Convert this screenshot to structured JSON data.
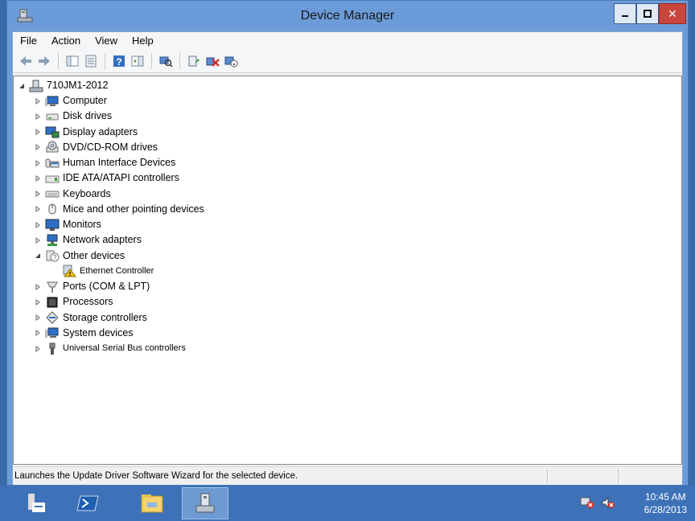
{
  "window": {
    "title": "Device Manager"
  },
  "menu": [
    "File",
    "Action",
    "View",
    "Help"
  ],
  "toolbar": [
    "back-icon",
    "forward-icon",
    "console-tree-icon",
    "properties-icon",
    "help-icon",
    "action-pane-icon",
    "scan-hardware-icon",
    "update-driver-icon",
    "uninstall-device-icon",
    "disable-device-icon"
  ],
  "tree": {
    "root": "710JM1-2012",
    "items": [
      {
        "label": "Computer",
        "icon": "computer-icon",
        "expanded": false
      },
      {
        "label": "Disk drives",
        "icon": "disk-drive-icon",
        "expanded": false
      },
      {
        "label": "Display adapters",
        "icon": "display-adapter-icon",
        "expanded": false
      },
      {
        "label": "DVD/CD-ROM drives",
        "icon": "dvd-drive-icon",
        "expanded": false
      },
      {
        "label": "Human Interface Devices",
        "icon": "hid-icon",
        "expanded": false
      },
      {
        "label": "IDE ATA/ATAPI controllers",
        "icon": "ide-controller-icon",
        "expanded": false
      },
      {
        "label": "Keyboards",
        "icon": "keyboard-icon",
        "expanded": false
      },
      {
        "label": "Mice and other pointing devices",
        "icon": "mouse-icon",
        "expanded": false
      },
      {
        "label": "Monitors",
        "icon": "monitor-icon",
        "expanded": false
      },
      {
        "label": "Network adapters",
        "icon": "network-adapter-icon",
        "expanded": false
      },
      {
        "label": "Other devices",
        "icon": "unknown-device-icon",
        "expanded": true
      },
      {
        "label": "Ethernet Controller",
        "icon": "warning-device-icon",
        "child": true
      },
      {
        "label": "Ports (COM & LPT)",
        "icon": "port-icon",
        "expanded": false
      },
      {
        "label": "Processors",
        "icon": "processor-icon",
        "expanded": false
      },
      {
        "label": "Storage controllers",
        "icon": "storage-controller-icon",
        "expanded": false
      },
      {
        "label": "System devices",
        "icon": "system-device-icon",
        "expanded": false
      },
      {
        "label": "Universal Serial Bus controllers",
        "icon": "usb-icon",
        "expanded": false
      }
    ]
  },
  "status": {
    "text": "Launches the Update Driver Software Wizard for the selected device."
  },
  "taskbar": {
    "apps": [
      "server-manager-icon",
      "powershell-icon",
      "file-explorer-icon",
      "device-manager-icon"
    ],
    "time": "10:45 AM",
    "date": "6/28/2013"
  },
  "colors": {
    "titlebar": "#6b9bd8",
    "taskbar": "#3d72b8"
  }
}
